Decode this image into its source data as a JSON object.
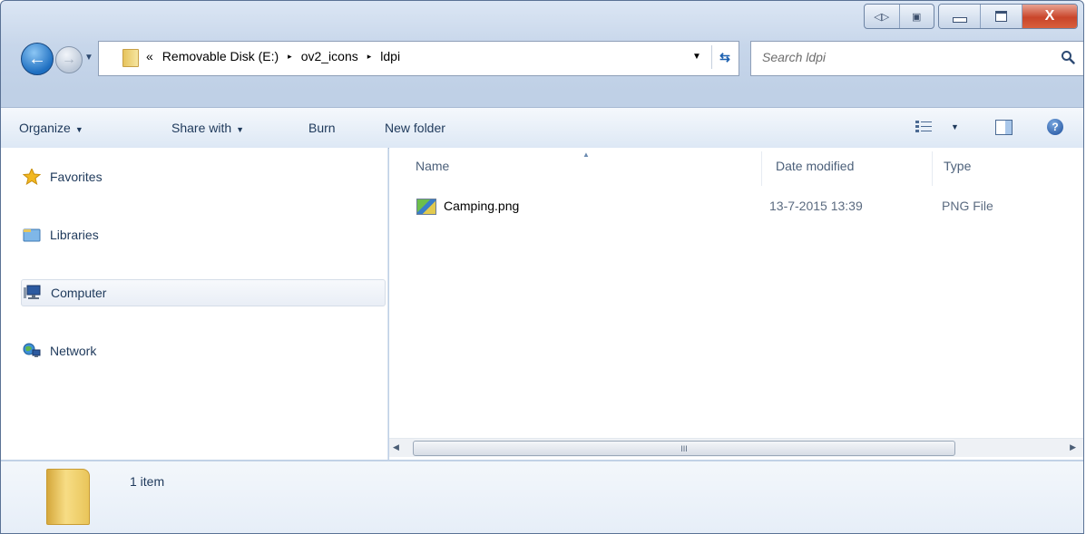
{
  "window": {
    "caption_ext_left": "◁▷",
    "caption_ext_right": "▣",
    "close_label": "X"
  },
  "address_bar": {
    "overflow": "«",
    "crumbs": [
      "Removable Disk (E:)",
      "ov2_icons",
      "ldpi"
    ],
    "separator": "▸"
  },
  "search": {
    "placeholder": "Search ldpi"
  },
  "toolbar": {
    "organize": "Organize",
    "share_with": "Share with",
    "burn": "Burn",
    "new_folder": "New folder",
    "dropdown_glyph": "▼"
  },
  "nav_pane": {
    "items": [
      {
        "label": "Favorites",
        "icon": "star-icon"
      },
      {
        "label": "Libraries",
        "icon": "libraries-icon"
      },
      {
        "label": "Computer",
        "icon": "computer-icon"
      },
      {
        "label": "Network",
        "icon": "network-icon"
      }
    ],
    "selected": "Computer"
  },
  "file_list": {
    "columns": [
      "Name",
      "Date modified",
      "Type"
    ],
    "sort_column": "Name",
    "rows": [
      {
        "name": "Camping.png",
        "date_modified": "13-7-2015 13:39",
        "type": "PNG File",
        "icon": "png-image-icon"
      }
    ]
  },
  "scrollbar": {
    "grip": "III"
  },
  "details": {
    "item_count": "1 item"
  },
  "colors": {
    "window_frame": "#bfd0e6",
    "accent_text": "#1e395b",
    "close_button": "#c9452a"
  }
}
